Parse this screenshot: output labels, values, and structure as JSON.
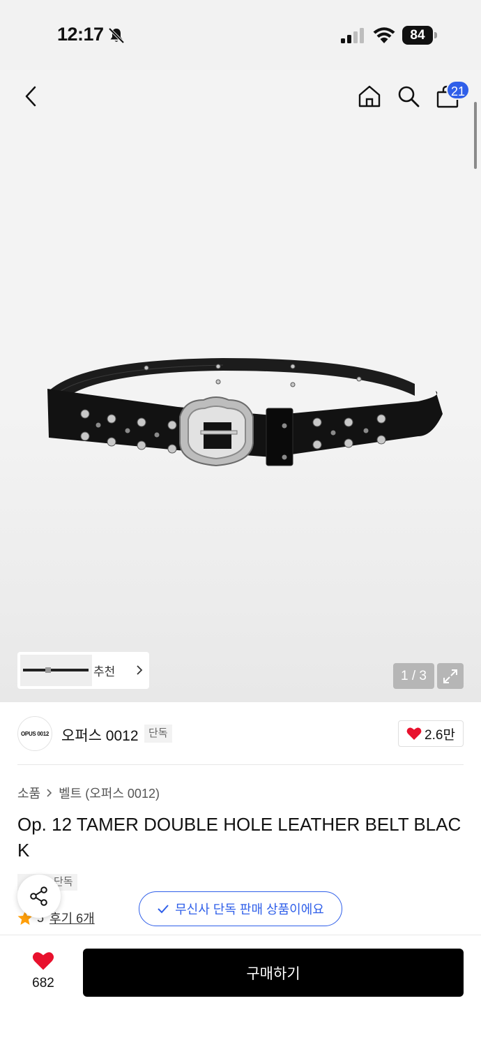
{
  "status_bar": {
    "time": "12:17",
    "battery": "84"
  },
  "header": {
    "cart_count": "21"
  },
  "gallery": {
    "recommend_label": "추천",
    "page_counter": "1 / 3"
  },
  "brand": {
    "logo_text": "OPUS 0012",
    "name": "오퍼스 0012",
    "tag": "단독",
    "like_count": "2.6만"
  },
  "breadcrumb": {
    "category": "소품",
    "subcategory": "벨트 (오퍼스 0012)"
  },
  "product": {
    "title": "Op. 12 TAMER DOUBLE HOLE LEATHER BELT BLACK",
    "tag_partial": "단독",
    "rating": "5",
    "review_label": "후기 6개",
    "exclusive_notice": "무신사 단독 판매 상품이에요"
  },
  "bottom_bar": {
    "like_count": "682",
    "buy_label": "구매하기"
  },
  "colors": {
    "accent_blue": "#2f5fe9",
    "heart_red": "#e8112d",
    "star_orange": "#ff9f0a",
    "buy_bg": "#000000"
  },
  "icons": [
    "bell-slash-icon",
    "back-chevron-icon",
    "home-icon",
    "search-icon",
    "shopping-bag-icon",
    "expand-icon",
    "heart-icon",
    "star-icon",
    "share-icon",
    "check-icon"
  ]
}
